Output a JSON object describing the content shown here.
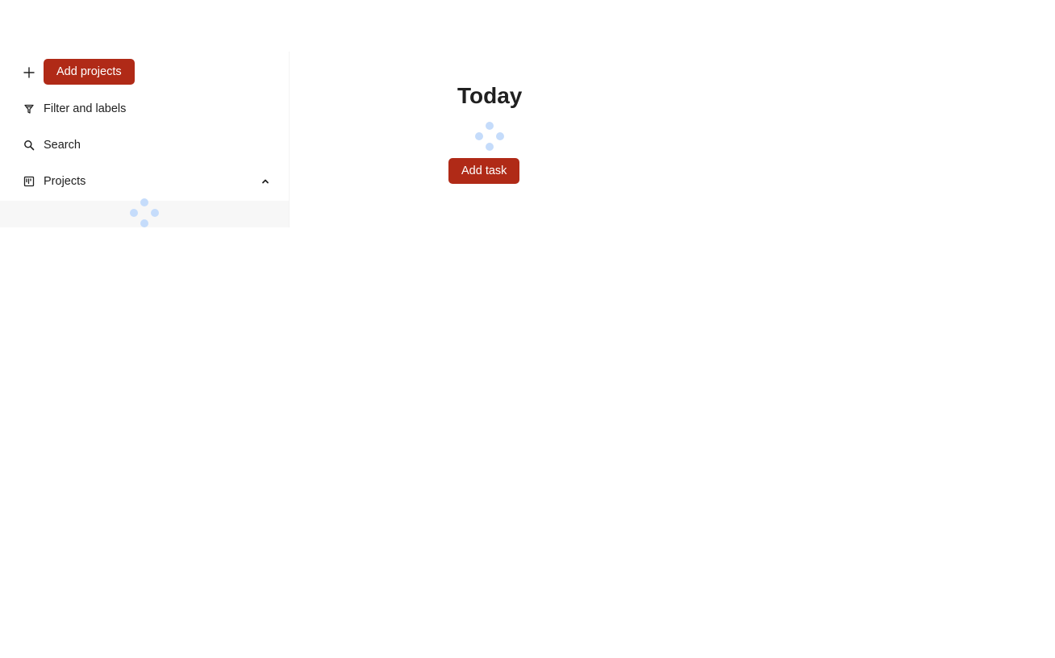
{
  "sidebar": {
    "add_projects": {
      "icon": "plus-icon",
      "label": "Add projects"
    },
    "filter": {
      "icon": "filter-icon",
      "label": "Filter and labels"
    },
    "search": {
      "icon": "search-icon",
      "label": "Search"
    },
    "projects": {
      "icon": "projects-board-icon",
      "label": "Projects",
      "toggle_icon": "chevron-up-icon",
      "expanded": true,
      "loading": true
    }
  },
  "main": {
    "title": "Today",
    "loading": true,
    "add_task_label": "Add task"
  },
  "colors": {
    "accent": "#b02a17",
    "spinner": "#c5dcfb",
    "text": "#202020",
    "loading_row_bg": "#f7f7f7"
  }
}
